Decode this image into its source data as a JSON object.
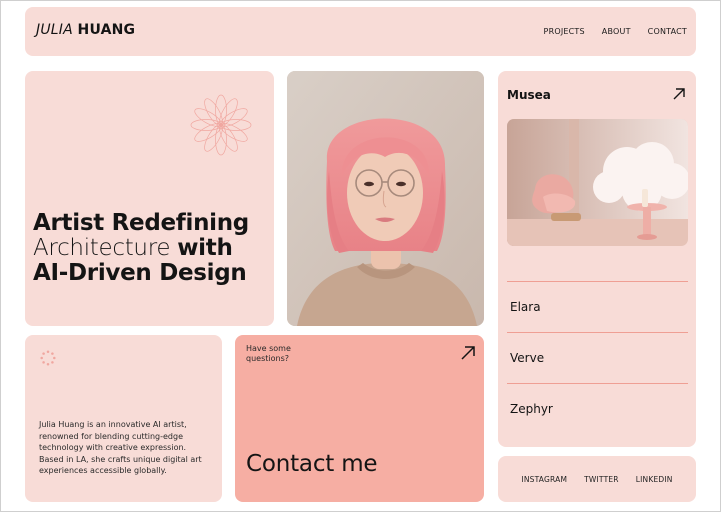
{
  "header": {
    "logo_first": "JULIA",
    "logo_last": "HUANG",
    "nav": [
      "PROJECTS",
      "ABOUT",
      "CONTACT"
    ]
  },
  "hero": {
    "line1_bold": "Artist Redefining",
    "line2_light": "Architecture",
    "line2_bold": "with",
    "line3_bold": "AI-Driven Design"
  },
  "projects": {
    "title": "Musea",
    "items": [
      "Elara",
      "Verve",
      "Zephyr"
    ]
  },
  "about": {
    "text": "Julia Huang is an innovative AI artist, renowned for blending cutting-edge technology with creative expression. Based in LA, she crafts unique digital art experiences accessible globally."
  },
  "contact": {
    "question": "Have some questions?",
    "title": "Contact me"
  },
  "socials": [
    "INSTAGRAM",
    "TWITTER",
    "LINKEDIN"
  ],
  "colors": {
    "card": "#f8dcd7",
    "contact_card": "#f6aea3",
    "divider": "#ef9f94",
    "accent_pink": "#f0a7a0"
  },
  "icons": {
    "flower": "flower-outline-icon",
    "spinner": "dotted-ring-icon",
    "arrow": "arrow-up-right-icon"
  }
}
